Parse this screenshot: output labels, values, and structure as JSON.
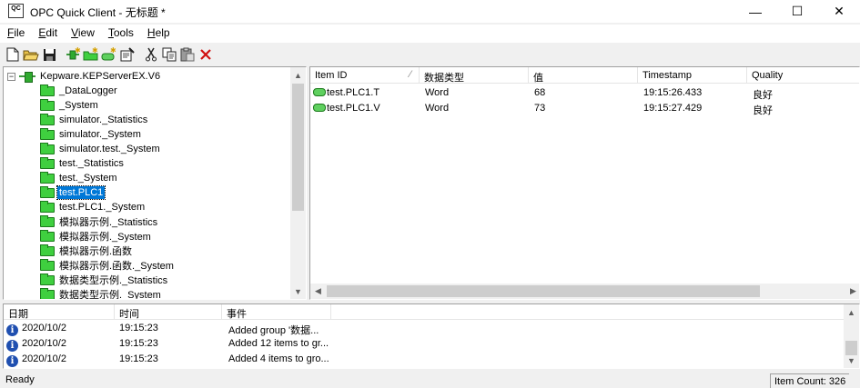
{
  "window": {
    "title": "OPC Quick Client - 无标题 *",
    "app_icon_text": "QC",
    "minimize_glyph": "—",
    "maximize_glyph": "☐",
    "close_glyph": "✕"
  },
  "menu": [
    {
      "u": "F",
      "rest": "ile"
    },
    {
      "u": "E",
      "rest": "dit"
    },
    {
      "u": "V",
      "rest": "iew"
    },
    {
      "u": "T",
      "rest": "ools"
    },
    {
      "u": "H",
      "rest": "elp"
    }
  ],
  "toolbar": [
    "new-icon",
    "open-icon",
    "save-icon",
    "new-server-icon",
    "new-group-icon",
    "new-item-icon",
    "properties-icon",
    "cut-icon",
    "copy-icon",
    "paste-icon",
    "delete-icon"
  ],
  "tree": {
    "server": "Kepware.KEPServerEX.V6",
    "groups": [
      "_DataLogger",
      "_System",
      "simulator._Statistics",
      "simulator._System",
      "simulator.test._System",
      "test._Statistics",
      "test._System",
      "test.PLC1",
      "test.PLC1._System",
      "模拟器示例._Statistics",
      "模拟器示例._System",
      "模拟器示例.函数",
      "模拟器示例.函数._System",
      "数据类型示例._Statistics",
      "数据类型示例._System"
    ],
    "selected_index": 7
  },
  "items": {
    "columns": [
      "Item ID",
      "数据类型",
      "值",
      "Timestamp",
      "Quality"
    ],
    "rows": [
      {
        "id": "test.PLC1.T",
        "type": "Word",
        "value": "68",
        "timestamp": "19:15:26.433",
        "quality": "良好"
      },
      {
        "id": "test.PLC1.V",
        "type": "Word",
        "value": "73",
        "timestamp": "19:15:27.429",
        "quality": "良好"
      }
    ]
  },
  "log": {
    "columns": [
      "日期",
      "时间",
      "事件"
    ],
    "rows": [
      {
        "date": "2020/10/2",
        "time": "19:15:23",
        "event": "Added group '数据..."
      },
      {
        "date": "2020/10/2",
        "time": "19:15:23",
        "event": "Added 12 items to gr..."
      },
      {
        "date": "2020/10/2",
        "time": "19:15:23",
        "event": "Added 4 items to gro..."
      }
    ]
  },
  "status": {
    "ready": "Ready",
    "item_count": "Item Count: 326"
  }
}
